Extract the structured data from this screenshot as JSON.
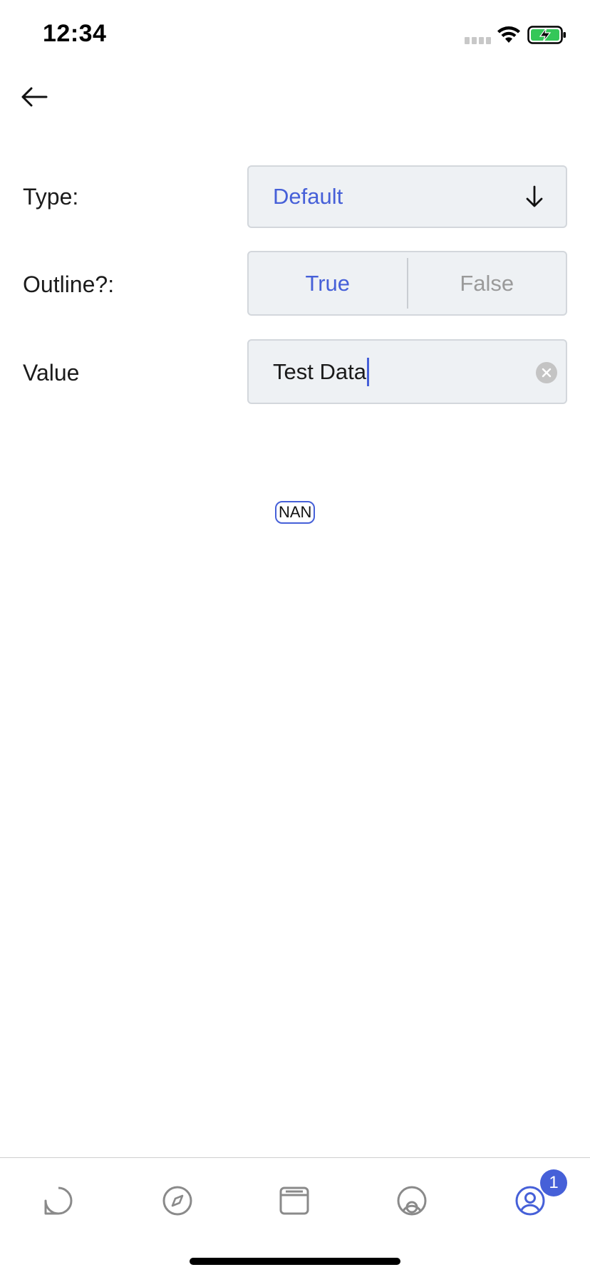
{
  "status_bar": {
    "time": "12:34",
    "icons": [
      "cellular-signal-icon",
      "wifi-icon",
      "battery-charging-icon"
    ],
    "battery_color": "#34c759"
  },
  "navigation": {
    "back_icon": "arrow-left-icon"
  },
  "form": {
    "type": {
      "label": "Type:",
      "selected_value": "Default",
      "icon": "arrow-down-icon"
    },
    "outline": {
      "label": "Outline?:",
      "options": [
        "True",
        "False"
      ],
      "selected": "True"
    },
    "value": {
      "label": "Value",
      "input_value": "Test Data",
      "clear_icon": "clear-x-icon"
    }
  },
  "badge_preview": {
    "text": "NAN"
  },
  "tab_bar": {
    "tabs": [
      {
        "icon": "chat-bubble-icon"
      },
      {
        "icon": "compass-icon"
      },
      {
        "icon": "calendar-icon"
      },
      {
        "icon": "location-icon"
      },
      {
        "icon": "profile-icon",
        "badge": "1",
        "active": true
      }
    ]
  },
  "colors": {
    "accent": "#4660d8",
    "field_background": "#eef1f4",
    "field_border": "#d3d7dc",
    "inactive_text": "#9a9a9a",
    "tab_icon": "#8a8a8a"
  }
}
